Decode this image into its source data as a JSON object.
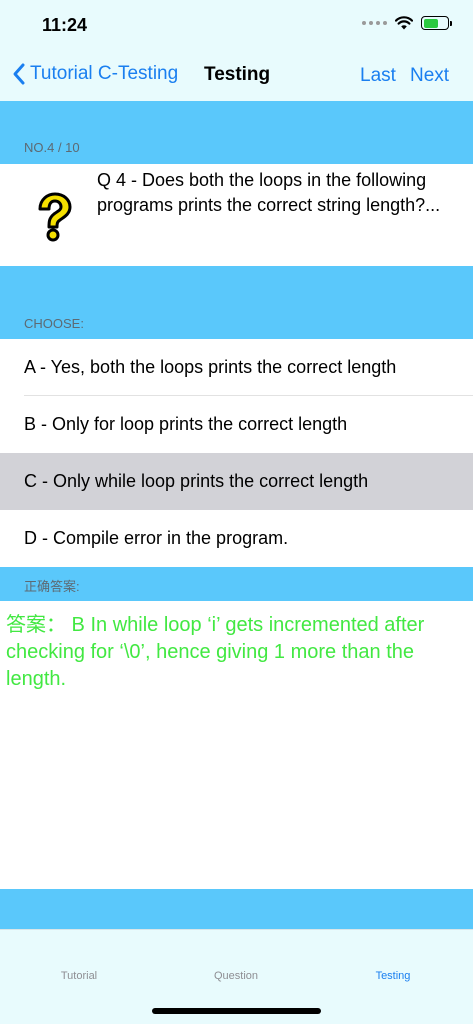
{
  "status_bar": {
    "time": "11:24"
  },
  "nav": {
    "back_label": "Tutorial C-Testing",
    "title": "Testing",
    "last_label": "Last",
    "next_label": "Next"
  },
  "question": {
    "number_label": "NO.4 / 10",
    "text": "Q 4 - Does both the loops in the following programs prints the correct string length?...",
    "icon": "question-mark-icon"
  },
  "choose_label": "CHOOSE:",
  "options": [
    {
      "label": "A - Yes, both the loops prints the correct length",
      "selected": false
    },
    {
      "label": "B - Only for loop prints the correct length",
      "selected": false
    },
    {
      "label": "C - Only while loop prints the correct length",
      "selected": true
    },
    {
      "label": "D - Compile error in the program.",
      "selected": false
    }
  ],
  "answer": {
    "header": "正确答案:",
    "text": "答案： B  In while loop ‘i’ gets incremented after checking for ‘\\0’, hence giving 1 more than the length."
  },
  "tabs": [
    {
      "label": "Tutorial",
      "active": false
    },
    {
      "label": "Question",
      "active": false
    },
    {
      "label": "Testing",
      "active": true
    }
  ],
  "colors": {
    "accent": "#1a7ff0",
    "band": "#5ac8fb",
    "answer": "#42e842",
    "selected_row": "#d2d2d7",
    "bar_bg": "#e8fbfd"
  }
}
